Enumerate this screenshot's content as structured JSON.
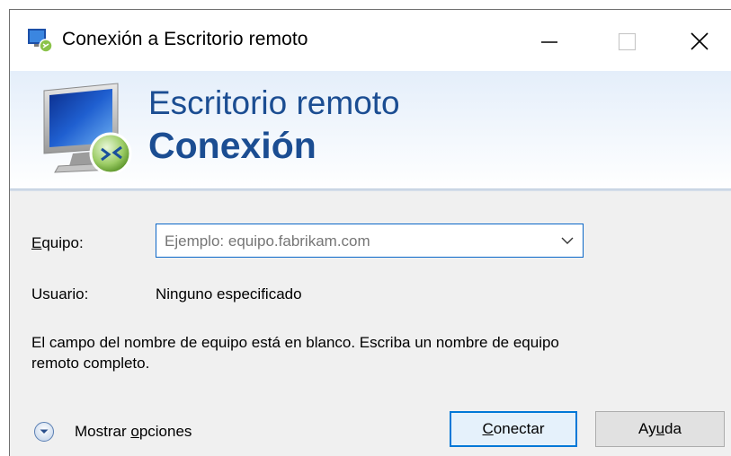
{
  "window": {
    "title": "Conexión a Escritorio remoto"
  },
  "header": {
    "line1": "Escritorio remoto",
    "line2": "Conexión"
  },
  "form": {
    "equipo": {
      "label_accel": "E",
      "label_rest": "quipo:",
      "placeholder": "Ejemplo: equipo.fabrikam.com"
    },
    "usuario": {
      "label": "Usuario:",
      "value": "Ninguno especificado"
    },
    "message": "El campo del nombre de equipo está en blanco. Escriba un nombre de equipo remoto completo."
  },
  "footer": {
    "options_pre": "Mostrar ",
    "options_accel": "o",
    "options_post": "pciones",
    "connect_accel": "C",
    "connect_rest": "onectar",
    "help_pre": "Ay",
    "help_accel": "u",
    "help_post": "da"
  },
  "icons": {
    "app": "remote-desktop-icon",
    "minimize": "minimize-icon",
    "maximize": "maximize-icon",
    "close": "close-icon",
    "monitor": "remote-desktop-monitor-icon",
    "dropdown": "chevron-down-icon",
    "options": "expand-circle-icon"
  },
  "colors": {
    "accent": "#0078d7",
    "header_text": "#1b4d92",
    "window_bg": "#f0f0f0"
  }
}
